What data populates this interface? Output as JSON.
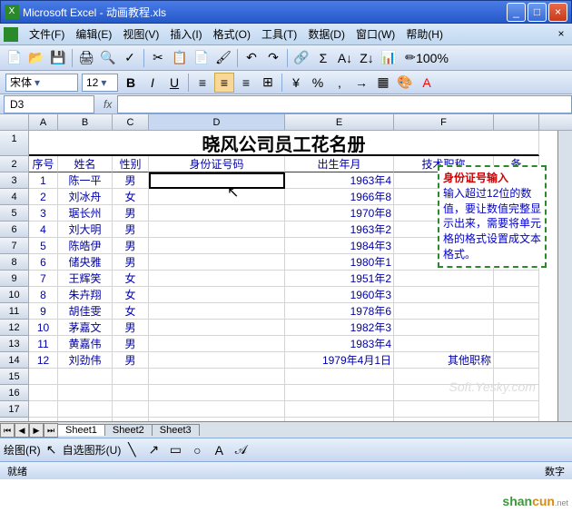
{
  "window": {
    "title": "Microsoft Excel - 动画教程.xls",
    "min": "_",
    "max": "□",
    "close": "×"
  },
  "menu": {
    "file": "文件(F)",
    "edit": "编辑(E)",
    "view": "视图(V)",
    "insert": "插入(I)",
    "format": "格式(O)",
    "tools": "工具(T)",
    "data": "数据(D)",
    "window": "窗口(W)",
    "help": "帮助(H)"
  },
  "format_toolbar": {
    "font": "宋体",
    "size": "12",
    "bold": "B",
    "italic": "I",
    "underline": "U"
  },
  "formula": {
    "namebox": "D3",
    "fx": "fx"
  },
  "columns": [
    "A",
    "B",
    "C",
    "D",
    "E",
    "F"
  ],
  "sheet": {
    "title": "晓风公司员工花名册",
    "headers": {
      "no": "序号",
      "name": "姓名",
      "sex": "性别",
      "id": "身份证号码",
      "birth": "出生年月",
      "title": "技术职称",
      "note": "备"
    },
    "rows": [
      {
        "no": "1",
        "name": "陈一平",
        "sex": "男",
        "birth": "1963年4"
      },
      {
        "no": "2",
        "name": "刘冰舟",
        "sex": "女",
        "birth": "1966年8"
      },
      {
        "no": "3",
        "name": "琚长州",
        "sex": "男",
        "birth": "1970年8"
      },
      {
        "no": "4",
        "name": "刘大明",
        "sex": "男",
        "birth": "1963年2"
      },
      {
        "no": "5",
        "name": "陈皓伊",
        "sex": "男",
        "birth": "1984年3"
      },
      {
        "no": "6",
        "name": "储央雅",
        "sex": "男",
        "birth": "1980年1"
      },
      {
        "no": "7",
        "name": "王辉笑",
        "sex": "女",
        "birth": "1951年2"
      },
      {
        "no": "8",
        "name": "朱卉翔",
        "sex": "女",
        "birth": "1960年3"
      },
      {
        "no": "9",
        "name": "胡佳雯",
        "sex": "女",
        "birth": "1978年6"
      },
      {
        "no": "10",
        "name": "茅嘉文",
        "sex": "男",
        "birth": "1982年3"
      },
      {
        "no": "11",
        "name": "黄嘉伟",
        "sex": "男",
        "birth": "1983年4"
      },
      {
        "no": "12",
        "name": "刘劲伟",
        "sex": "男",
        "birth": "1979年4月1日",
        "title": "其他职称"
      }
    ]
  },
  "callout": {
    "title": "身份证号输入",
    "body": "输入超过12位的数值，要让数值完整显示出来，需要将单元格的格式设置成文本格式。"
  },
  "tabs": {
    "s1": "Sheet1",
    "s2": "Sheet2",
    "s3": "Sheet3"
  },
  "toolbar2": {
    "draw": "绘图(R)",
    "autoshape": "自选图形(U)"
  },
  "status": {
    "ready": "就绪",
    "num": "数字"
  },
  "watermark": "Soft.Yesky.com",
  "wm2a": "shan",
  "wm2b": "cun",
  "wm2c": ".net"
}
